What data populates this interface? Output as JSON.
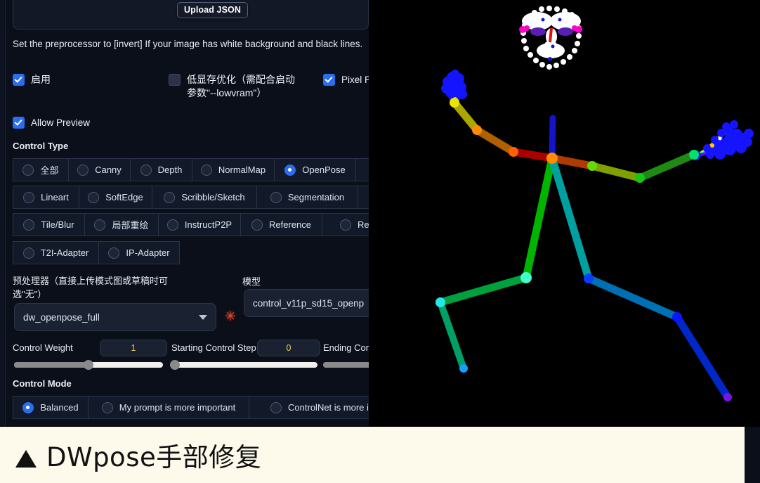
{
  "panel": {
    "upload_json_button": "Upload JSON",
    "hint": "Set the preprocessor to [invert] If your image has white background and black lines.",
    "checkboxes": [
      {
        "label": "启用",
        "checked": true
      },
      {
        "label": "低显存优化（需配合启动参数\"--lowvram\"）",
        "checked": false
      },
      {
        "label": "Pixel P",
        "checked": true
      },
      {
        "label": "Allow Preview",
        "checked": true
      }
    ],
    "control_type": {
      "label": "Control Type",
      "options": [
        {
          "label": "全部",
          "selected": false
        },
        {
          "label": "Canny",
          "selected": false
        },
        {
          "label": "Depth",
          "selected": false
        },
        {
          "label": "NormalMap",
          "selected": false
        },
        {
          "label": "OpenPose",
          "selected": true
        },
        {
          "label": "Lineart",
          "selected": false
        },
        {
          "label": "SoftEdge",
          "selected": false
        },
        {
          "label": "Scribble/Sketch",
          "selected": false
        },
        {
          "label": "Segmentation",
          "selected": false
        },
        {
          "label": "Tile/Blur",
          "selected": false
        },
        {
          "label": "局部重绘",
          "selected": false
        },
        {
          "label": "InstructP2P",
          "selected": false
        },
        {
          "label": "Reference",
          "selected": false
        },
        {
          "label": "Rec",
          "selected": false
        },
        {
          "label": "T2I-Adapter",
          "selected": false
        },
        {
          "label": "IP-Adapter",
          "selected": false
        }
      ]
    },
    "preprocessor": {
      "label": "预处理器（直接上传模式图或草稿时可选\"无\"）",
      "value": "dw_openpose_full",
      "run_icon": "spark-icon"
    },
    "model": {
      "label": "模型",
      "value": "control_v11p_sd15_openp"
    },
    "sliders": [
      {
        "label": "Control Weight",
        "value": "1",
        "percent": 50
      },
      {
        "label": "Starting Control Step",
        "value": "0",
        "percent": 0
      },
      {
        "label": "Ending Con",
        "value": "",
        "percent": 100
      }
    ],
    "control_mode": {
      "label": "Control Mode",
      "options": [
        {
          "label": "Balanced",
          "selected": true
        },
        {
          "label": "My prompt is more important",
          "selected": false
        },
        {
          "label": "ControlNet is more imp",
          "selected": false
        }
      ]
    }
  },
  "pose_preview": {
    "name": "openpose-skeleton-preview",
    "background": "#000000",
    "description": "DWpose full-body skeleton with face keypoints and two detected hands"
  },
  "caption": {
    "marker": "▲",
    "text": "DWpose手部修复"
  }
}
